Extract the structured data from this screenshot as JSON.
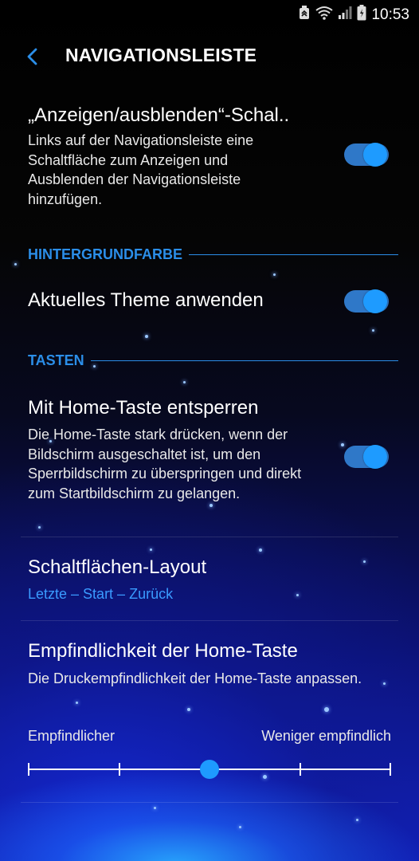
{
  "status_bar": {
    "time": "10:53"
  },
  "header": {
    "title": "NAVIGATIONSLEISTE"
  },
  "show_hide": {
    "title": "„Anzeigen/ausblenden“-Schal..",
    "description": "Links auf der Navigationsleiste eine Schaltfläche zum Anzeigen und Ausblenden der Navigationsleiste hinzufügen.",
    "enabled": true
  },
  "section_background": {
    "label": "HINTERGRUNDFARBE"
  },
  "apply_theme": {
    "title": "Aktuelles Theme anwenden",
    "enabled": true
  },
  "section_keys": {
    "label": "TASTEN"
  },
  "home_unlock": {
    "title": "Mit Home-Taste entsperren",
    "description": "Die Home-Taste stark drücken, wenn der Bildschirm ausgeschaltet ist, um den Sperrbildschirm zu überspringen und direkt zum Startbildschirm zu gelangen.",
    "enabled": true
  },
  "button_layout": {
    "title": "Schaltflächen-Layout",
    "value": "Letzte – Start – Zurück"
  },
  "home_sensitivity": {
    "title": "Empfindlichkeit der Home-Taste",
    "description": "Die Druckempfindlichkeit der Home-Taste anpassen.",
    "label_min": "Empfindlicher",
    "label_max": "Weniger empfindlich",
    "steps": 5,
    "value_index": 2
  },
  "colors": {
    "accent": "#1e9bff",
    "section": "#2b8ee8",
    "toggle_track": "#2f78c8"
  },
  "icons": {
    "back": "chevron-left-icon",
    "battery": "battery-icon",
    "wifi": "wifi-icon",
    "signal": "signal-icon",
    "data_saver": "data-saver-icon"
  }
}
